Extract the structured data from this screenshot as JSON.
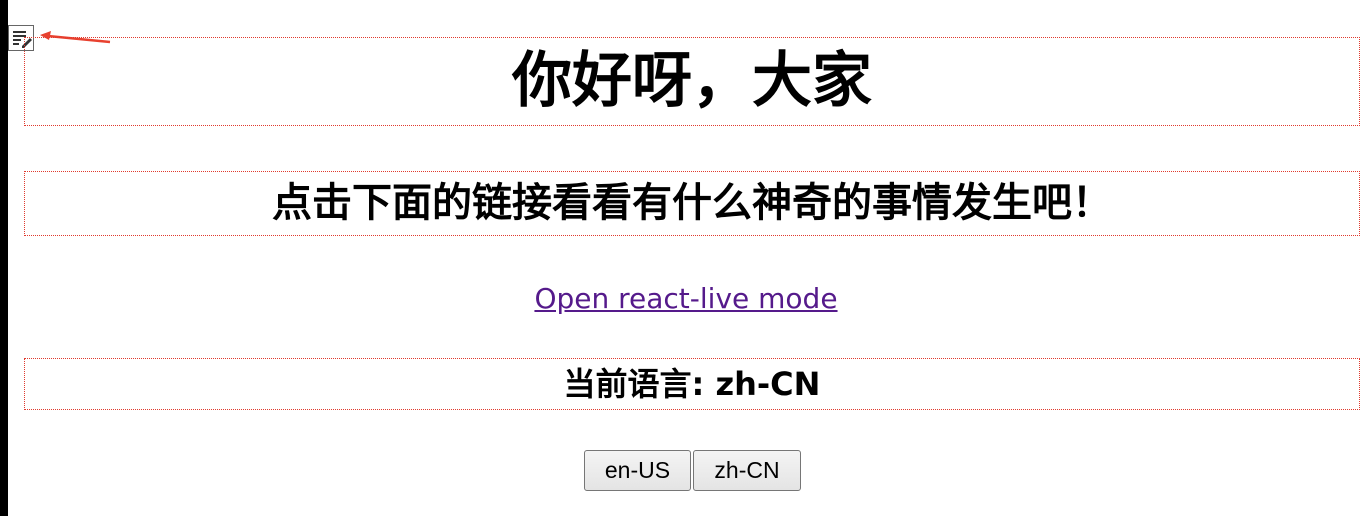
{
  "header": {
    "title": "你好呀，大家",
    "subtitle": "点击下面的链接看看有什么神奇的事情发生吧！"
  },
  "link": {
    "label": "Open react-live mode"
  },
  "language": {
    "current_text": "当前语言: zh-CN"
  },
  "buttons": {
    "en_label": "en-US",
    "zh_label": "zh-CN"
  },
  "icons": {
    "edit": "edit-document-icon",
    "arrow": "red-arrow-annotation"
  },
  "colors": {
    "box_border": "#e03a2e",
    "link": "#551a8b",
    "arrow": "#e8412f"
  }
}
